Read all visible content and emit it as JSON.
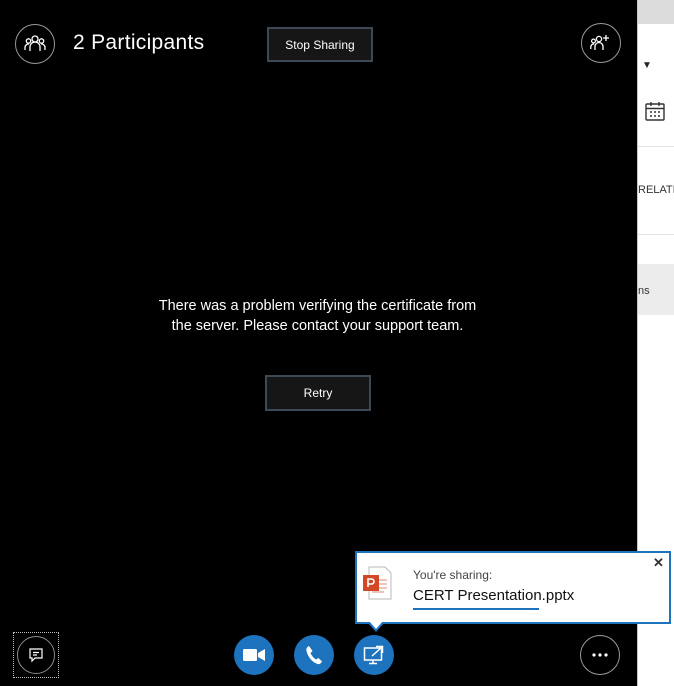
{
  "header": {
    "participants_label": "2 Participants",
    "stop_sharing_label": "Stop Sharing"
  },
  "message": {
    "text": "There was a problem verifying the certificate from the server. Please contact your support team.",
    "retry_label": "Retry"
  },
  "toolbar": {
    "icons": [
      "chat-icon",
      "video-icon",
      "phone-icon",
      "share-screen-icon",
      "more-options-icon"
    ]
  },
  "toast": {
    "label": "You're sharing:",
    "filename": "CERT Presentation.pptx",
    "close_glyph": "✕"
  },
  "right_panel": {
    "text_row_1": "RELATIO",
    "text_row_2": "ns"
  },
  "colors": {
    "stage_background": "#000000",
    "accent_blue": "#1e73be",
    "button_border": "#3d4a55",
    "powerpoint_red": "#d24726"
  }
}
